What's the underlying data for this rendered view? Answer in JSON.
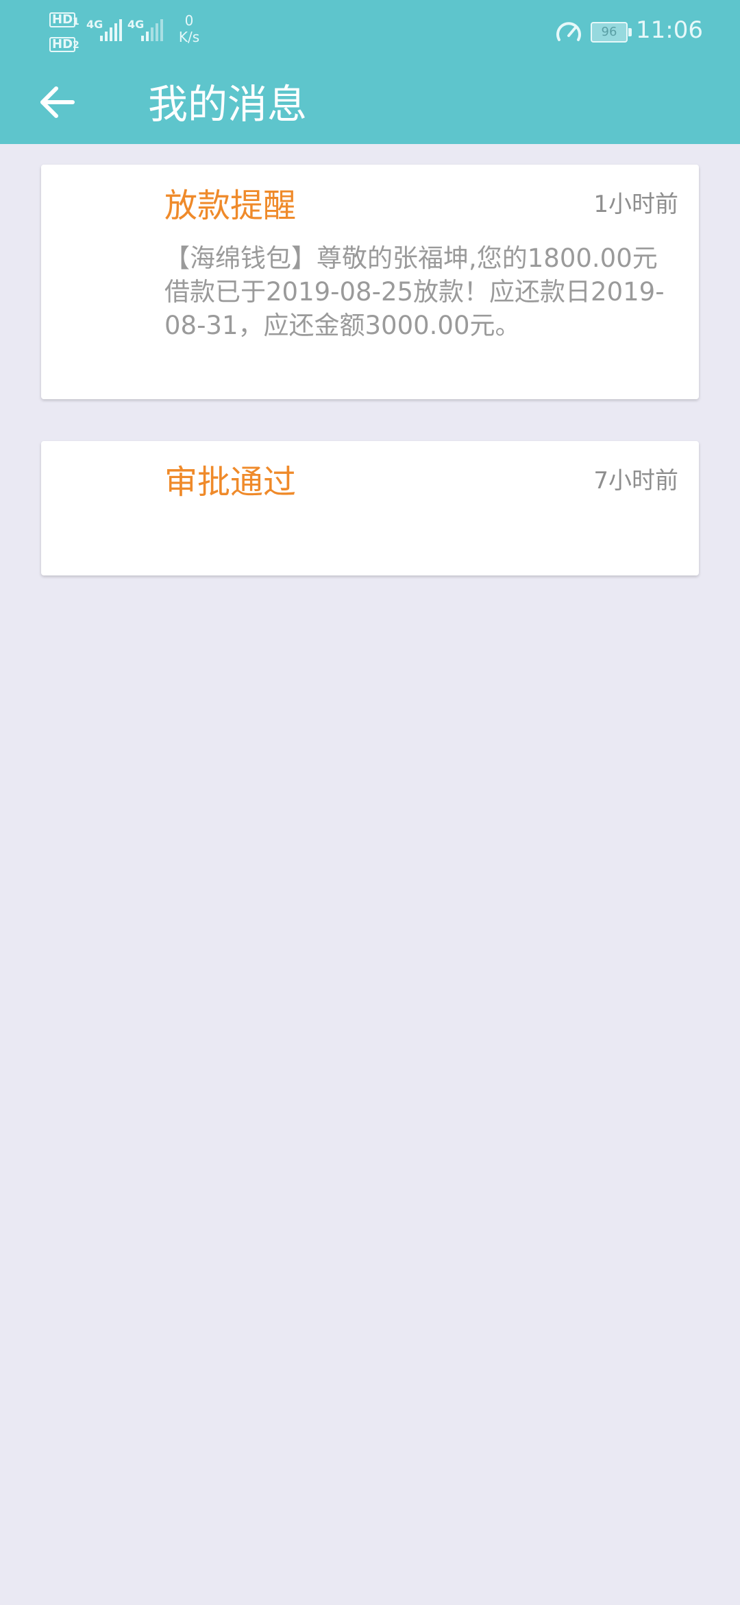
{
  "status_bar": {
    "hd1": "HD",
    "hd2": "HD",
    "sim1": "1",
    "sim2": "2",
    "net1": "4G",
    "net2": "4G",
    "speed_value": "0",
    "speed_unit": "K/s",
    "battery": "96",
    "time": "11:06"
  },
  "header": {
    "back_icon": "arrow-left-icon",
    "title": "我的消息",
    "color": "#5ec5cc"
  },
  "messages": [
    {
      "title": "放款提醒",
      "time": "1小时前",
      "body": "【海绵钱包】尊敬的张福坤,您的1800.00元借款已于2019-08-25放款！应还款日2019-08-31，应还金额3000.00元。"
    },
    {
      "title": "审批通过",
      "time": "7小时前",
      "body": ""
    }
  ],
  "colors": {
    "accent": "#ef8a2a",
    "background": "#eae9f3"
  }
}
